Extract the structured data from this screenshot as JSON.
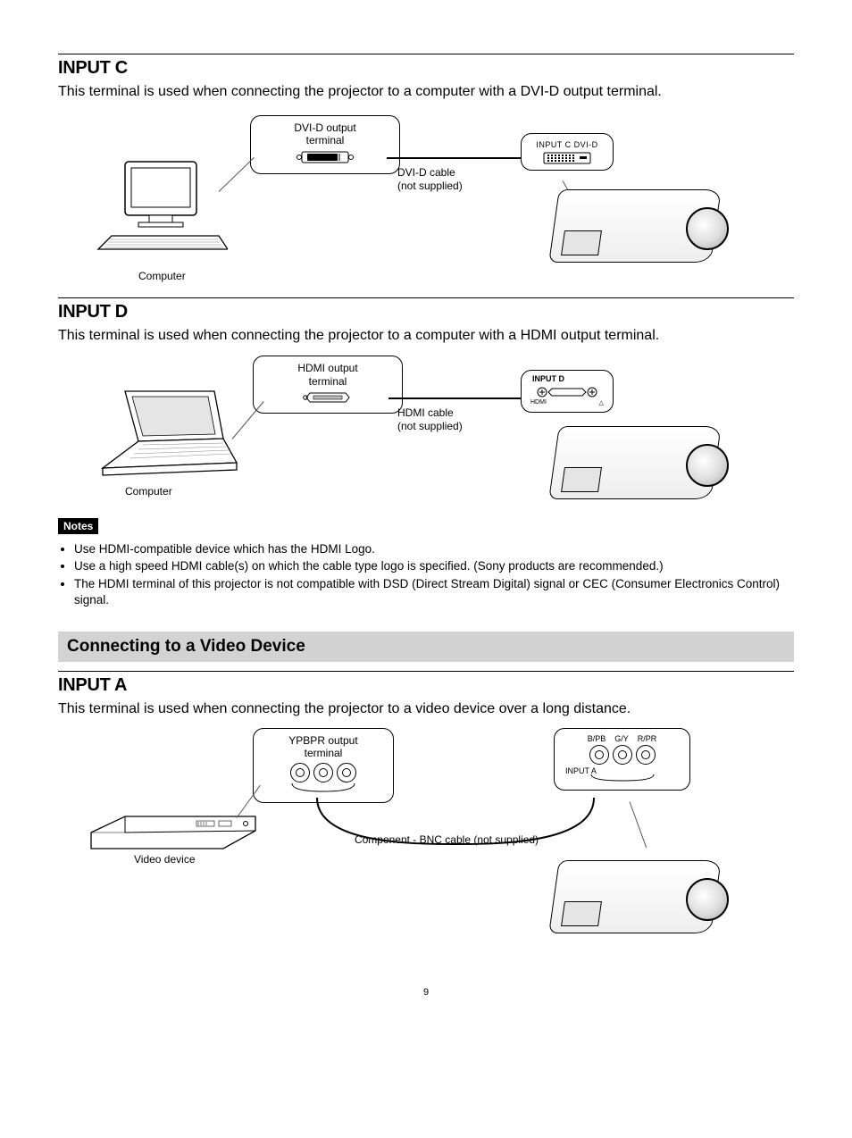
{
  "inputC": {
    "heading": "INPUT C",
    "body": "This terminal is used when connecting the projector to a computer with a DVI-D output terminal.",
    "termLabel1": "DVI-D output",
    "termLabel2": "terminal",
    "destLabel": "INPUT C  DVI-D",
    "cable1": "DVI-D cable",
    "cable2": "(not supplied)",
    "source": "Computer"
  },
  "inputD": {
    "heading": "INPUT D",
    "body": "This terminal is used when connecting the projector to a computer with a HDMI output terminal.",
    "termLabel1": "HDMI output",
    "termLabel2": "terminal",
    "destLabel": "INPUT D",
    "cable1": "HDMI cable",
    "cable2": "(not supplied)",
    "source": "Computer"
  },
  "notes": {
    "badge": "Notes",
    "items": [
      "Use HDMI-compatible device which has the HDMI Logo.",
      "Use a high speed HDMI cable(s) on which the cable type logo is specified. (Sony products are recommended.)",
      "The HDMI terminal of this projector is not compatible with DSD (Direct Stream Digital) signal or CEC (Consumer Electronics Control) signal."
    ]
  },
  "sectionBar": "Connecting to a Video Device",
  "inputA": {
    "heading": "INPUT A",
    "body": "This terminal is used when connecting the projector to a video device over a long distance.",
    "termLabel1": "YPBPR output",
    "termLabel2": "terminal",
    "cable": "Component - BNC cable (not supplied)",
    "destPanel": "INPUT A",
    "bnc1": "B/PB",
    "bnc2": "G/Y",
    "bnc3": "R/PR",
    "source": "Video device"
  },
  "pageNumber": "9"
}
